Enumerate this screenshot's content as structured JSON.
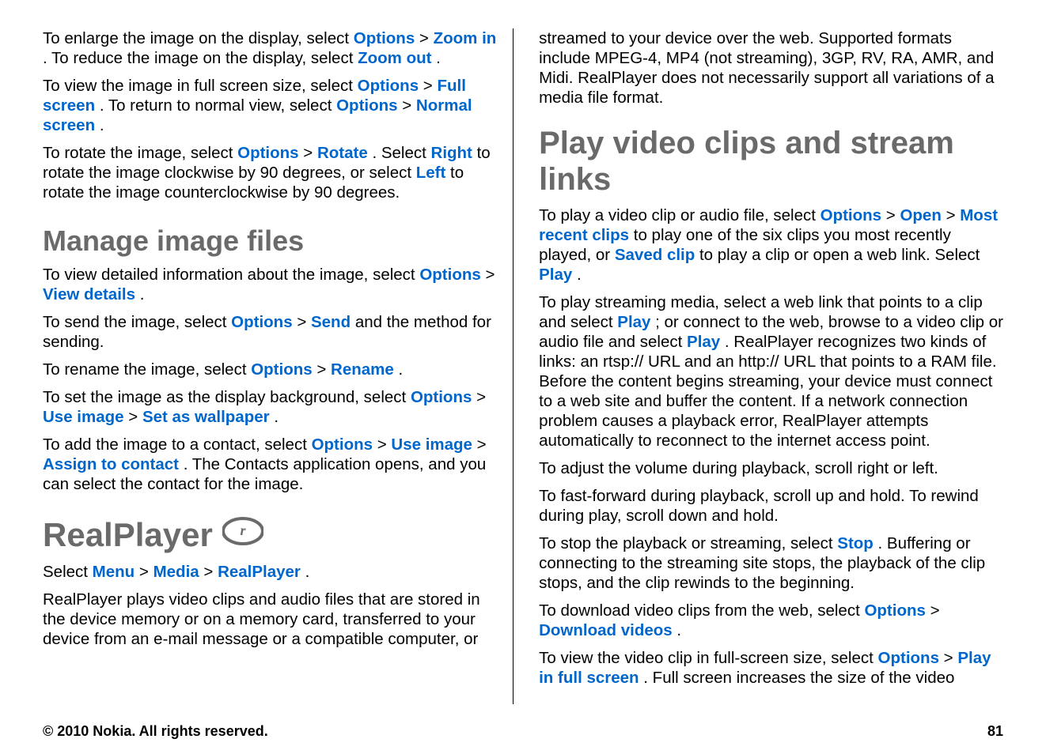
{
  "left": {
    "p1": {
      "t0": "To enlarge the image on the display, select ",
      "options": "Options",
      "gt1": " > ",
      "zoom_in": "Zoom in",
      "t1": ". To reduce the image on the display, select ",
      "zoom_out": "Zoom out",
      "t2": "."
    },
    "p2": {
      "t0": "To view the image in full screen size, select ",
      "options1": "Options",
      "gt1": " > ",
      "full_screen": "Full screen",
      "t1": ". To return to normal view, select ",
      "options2": "Options",
      "gt2": " > ",
      "normal_screen": "Normal screen",
      "t2": "."
    },
    "p3": {
      "t0": "To rotate the image, select ",
      "options": "Options",
      "gt1": " > ",
      "rotate": "Rotate",
      "t1": ". Select ",
      "right": "Right",
      "t2": " to rotate the image clockwise by 90 degrees, or select ",
      "left": "Left",
      "t3": " to rotate the image counterclockwise by 90 degrees."
    },
    "h_manage": "Manage image files",
    "p4": {
      "t0": "To view detailed information about the image, select ",
      "options": "Options",
      "gt1": " > ",
      "view_details": "View details",
      "t1": "."
    },
    "p5": {
      "t0": "To send the image, select ",
      "options": "Options",
      "gt1": " > ",
      "send": "Send",
      "t1": " and the method for sending."
    },
    "p6": {
      "t0": "To rename the image, select ",
      "options": "Options",
      "gt1": " > ",
      "rename": "Rename",
      "t1": "."
    },
    "p7": {
      "t0": "To set the image as the display background, select ",
      "options": "Options",
      "gt1": " > ",
      "use_image": "Use image",
      "gt2": " > ",
      "set_wallpaper": "Set as wallpaper",
      "t1": "."
    },
    "p8": {
      "t0": "To add the image to a contact, select ",
      "options": "Options",
      "gt1": " > ",
      "use_image": "Use image",
      "gt2": " > ",
      "assign_contact": "Assign to contact",
      "t1": ". The Contacts application opens, and you can select the contact for the image."
    },
    "h_realplayer": "RealPlayer ",
    "p9": {
      "t0": "Select ",
      "menu": "Menu",
      "gt1": " > ",
      "media": "Media",
      "gt2": " > ",
      "realplayer": "RealPlayer",
      "t1": "."
    },
    "p10": "RealPlayer plays video clips and audio files that are stored in the device memory or on a memory card, transferred to your device from an e-mail message or a compatible computer, or"
  },
  "right": {
    "p1": "streamed to your device over the web. Supported formats include MPEG-4, MP4 (not streaming), 3GP, RV, RA, AMR, and Midi. RealPlayer does not necessarily support all variations of a media file format.",
    "h_play": "Play video clips and stream links",
    "p2": {
      "t0": "To play a video clip or audio file, select ",
      "options": "Options",
      "gt1": " > ",
      "open": "Open",
      "gt2": " > ",
      "most_recent": "Most recent clips",
      "t1": " to play one of the six clips you most recently played, or ",
      "saved_clip": "Saved clip",
      "t2": " to play a clip or open a web link. Select ",
      "play": "Play",
      "t3": "."
    },
    "p3": {
      "t0": "To play streaming media, select a web link that points to a clip and select ",
      "play1": "Play",
      "t1": "; or connect to the web, browse to a video clip or audio file and select ",
      "play2": "Play",
      "t2": ". RealPlayer recognizes two kinds of links: an rtsp:// URL and an http:// URL that points to a RAM file. Before the content begins streaming, your device must connect to a web site and buffer the content. If a network connection problem causes a playback error, RealPlayer attempts automatically to reconnect to the internet access point."
    },
    "p4": "To adjust the volume during playback, scroll right or left.",
    "p5": "To fast-forward during playback, scroll up and hold. To rewind during play, scroll down and hold.",
    "p6": {
      "t0": "To stop the playback or streaming, select ",
      "stop": "Stop",
      "t1": ". Buffering or connecting to the streaming site stops, the playback of the clip stops, and the clip rewinds to the beginning."
    },
    "p7": {
      "t0": "To download video clips from the web, select ",
      "options": "Options",
      "gt1": " > ",
      "download_videos": "Download videos",
      "t1": "."
    },
    "p8": {
      "t0": "To view the video clip in full-screen size, select ",
      "options": "Options",
      "gt1": " > ",
      "play_full": "Play in full screen",
      "t1": ". Full screen increases the size of the video"
    }
  },
  "footer": {
    "copyright": "© 2010 Nokia. All rights reserved.",
    "page": "81"
  }
}
